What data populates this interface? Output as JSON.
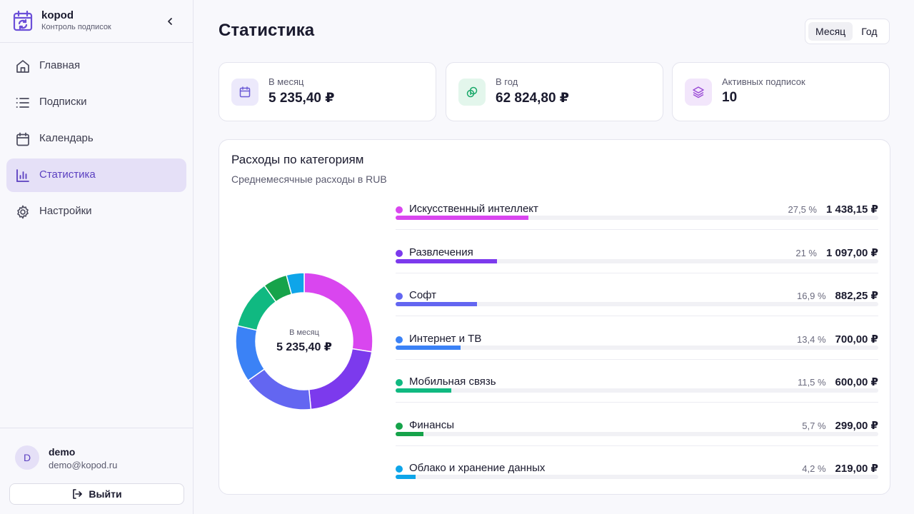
{
  "brand": {
    "name": "kopod",
    "subtitle": "Контроль подписок"
  },
  "nav": {
    "items": [
      {
        "label": "Главная",
        "icon": "home-icon",
        "active": false
      },
      {
        "label": "Подписки",
        "icon": "list-icon",
        "active": false
      },
      {
        "label": "Календарь",
        "icon": "calendar-icon",
        "active": false
      },
      {
        "label": "Статистика",
        "icon": "bar-chart-icon",
        "active": true
      },
      {
        "label": "Настройки",
        "icon": "gear-icon",
        "active": false
      }
    ]
  },
  "user": {
    "initial": "D",
    "name": "demo",
    "email": "demo@kopod.ru",
    "logout_label": "Выйти"
  },
  "page": {
    "title": "Статистика"
  },
  "period": {
    "options": [
      "Месяц",
      "Год"
    ],
    "selected": "Месяц"
  },
  "stats": [
    {
      "label": "В месяц",
      "value": "5 235,40 ₽",
      "icon": "calendar-icon",
      "color": "#6b5bd6",
      "bg": "#ece9fb"
    },
    {
      "label": "В год",
      "value": "62 824,80 ₽",
      "icon": "coins-icon",
      "color": "#1aa86a",
      "bg": "#e3f6ec"
    },
    {
      "label": "Активных подписок",
      "value": "10",
      "icon": "layers-icon",
      "color": "#9b4dd6",
      "bg": "#f2e6fb"
    }
  ],
  "categories_panel": {
    "title": "Расходы по категориям",
    "subtitle": "Среднемесячные расходы в RUB",
    "center_label": "В месяц",
    "center_value": "5 235,40 ₽"
  },
  "chart_data": {
    "type": "pie",
    "title": "Расходы по категориям",
    "subtitle": "Среднемесячные расходы в RUB",
    "categories": [
      "Искусственный интеллект",
      "Развлечения",
      "Софт",
      "Интернет и ТВ",
      "Мобильная связь",
      "Финансы",
      "Облако и хранение данных"
    ],
    "values": [
      1438.15,
      1097.0,
      882.25,
      700.0,
      600.0,
      299.0,
      219.0
    ],
    "percent_labels": [
      "27,5 %",
      "21 %",
      "16,9 %",
      "13,4 %",
      "11,5 %",
      "5,7 %",
      "4,2 %"
    ],
    "percents": [
      27.5,
      21,
      16.9,
      13.4,
      11.5,
      5.7,
      4.2
    ],
    "amount_labels": [
      "1 438,15 ₽",
      "1 097,00 ₽",
      "882,25 ₽",
      "700,00 ₽",
      "600,00 ₽",
      "299,00 ₽",
      "219,00 ₽"
    ],
    "colors": [
      "#d946ef",
      "#7c3aed",
      "#6366f1",
      "#3b82f6",
      "#10b981",
      "#16a34a",
      "#0ea5e9"
    ]
  }
}
